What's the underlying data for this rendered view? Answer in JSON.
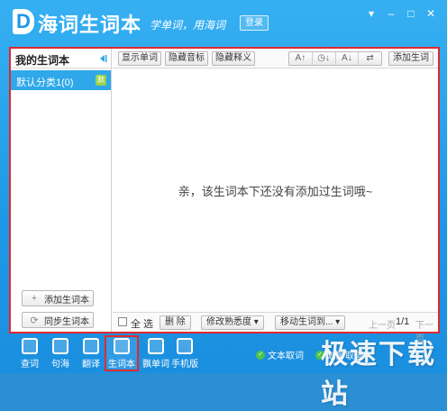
{
  "app": {
    "title": "海词生词本",
    "logo_letter": "D",
    "slogan": "学单词，用海词",
    "login_label": "登录"
  },
  "window_controls": [
    "▾",
    "–",
    "□",
    "✕"
  ],
  "sidebar": {
    "title": "我的生词本",
    "folders": [
      {
        "label": "默认分类1(0)",
        "badge": "默"
      }
    ],
    "add_book_label": "添加生词本",
    "sync_book_label": "同步生词本"
  },
  "toolbar": {
    "show_words": "显示单词",
    "hide_phonetic": "隐藏音标",
    "hide_meaning": "隐藏释义",
    "font_size": "A↑",
    "sort_time": "◷↓",
    "sort_alpha": "A↓",
    "shuffle": "⇄",
    "add_word": "添加生词"
  },
  "main": {
    "empty_message": "亲，该生词本下还没有添加过生词哦~"
  },
  "footer": {
    "select_all": "全 选",
    "delete": "删 除",
    "modify_familiarity": "修改熟悉度 ▾",
    "move_words": "移动生词到... ▾",
    "prev_page": "上一页",
    "page_indicator": "1/1",
    "next_page": "下一页"
  },
  "bottom_nav": [
    {
      "label": "查词",
      "icon": "search-icon"
    },
    {
      "label": "句海",
      "icon": "sentence-icon"
    },
    {
      "label": "翻译",
      "icon": "translate-icon"
    },
    {
      "label": "生词本",
      "icon": "wordbook-icon"
    },
    {
      "label": "飘单词",
      "icon": "float-word-icon"
    },
    {
      "label": "手机版",
      "icon": "mobile-icon"
    }
  ],
  "status": {
    "text_capture": "文本取词",
    "screen_capture": "划屏取词"
  },
  "watermark": "极速下载站",
  "colors": {
    "accent": "#2ea8ea",
    "highlight_border": "#e0292d",
    "titlebar": "#1e98e6"
  }
}
